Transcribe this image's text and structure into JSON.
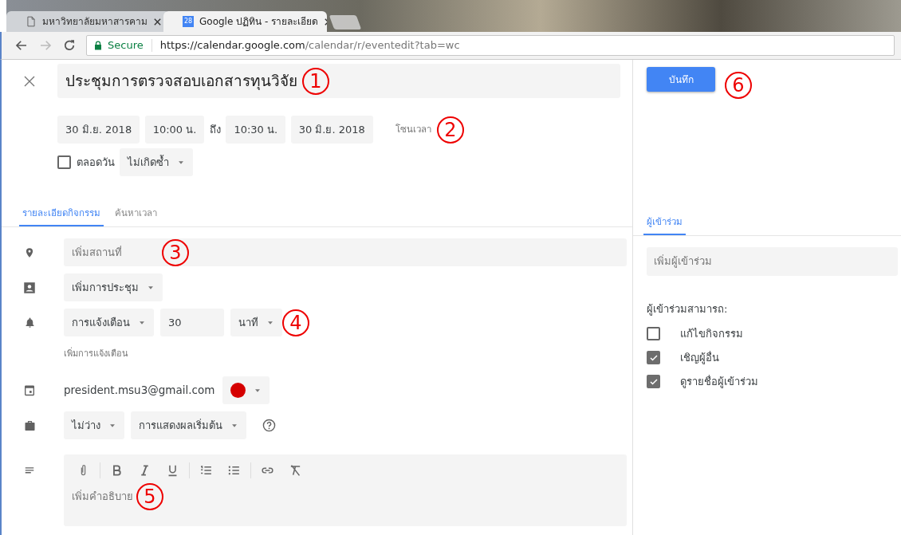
{
  "browser": {
    "tabs": [
      {
        "title": "มหาวิทยาลัยมหาสารคาม",
        "selected": false,
        "kind": "page"
      },
      {
        "title": "Google ปฏิทิน - รายละเอียด",
        "selected": true,
        "kind": "calendar",
        "favicon_text": "28"
      }
    ],
    "address": {
      "secure_label": "Secure",
      "url_host": "https://calendar.google.com",
      "url_path": "/calendar/r/eventedit?tab=wc"
    }
  },
  "event": {
    "title": "ประชุมการตรวจสอบเอกสารทุนวิจัย",
    "annotation": "1"
  },
  "save_button": {
    "label": "บันทึก",
    "annotation": "6"
  },
  "date_row": {
    "start_date": "30 มิ.ย. 2018",
    "start_time": "10:00 น.",
    "to_label": "ถึง",
    "end_time": "10:30 น.",
    "end_date": "30 มิ.ย. 2018",
    "timezone": "โซนเวลา",
    "annotation": "2"
  },
  "all_day": {
    "label": "ตลอดวัน",
    "checked": false
  },
  "repeat": "ไม่เกิดซ้ำ",
  "tabs": [
    {
      "label": "รายละเอียดกิจกรรม",
      "selected": true
    },
    {
      "label": "ค้นหาเวลา",
      "selected": false
    }
  ],
  "guests_tab": {
    "label": "ผู้เข้าร่วม",
    "selected": true
  },
  "location": {
    "placeholder": "เพิ่มสถานที่",
    "annotation": "3"
  },
  "conference": "เพิ่มการประชุม",
  "notification": {
    "type": "การแจ้งเตือน",
    "value": "30",
    "unit": "นาที",
    "annotation": "4"
  },
  "add_notification": "เพิ่มการแจ้งเตือน",
  "calendar": {
    "email": "president.msu3@gmail.com",
    "color": "#d50000"
  },
  "availability": "ไม่ว่าง",
  "visibility": "การแสดงผลเริ่มต้น",
  "description": {
    "placeholder": "เพิ่มคำอธิบาย",
    "annotation": "5"
  },
  "guests": {
    "placeholder": "เพิ่มผู้เข้าร่วม",
    "permissions_label": "ผู้เข้าร่วมสามารถ:",
    "permissions": [
      {
        "label": "แก้ไขกิจกรรม",
        "checked": false
      },
      {
        "label": "เชิญผู้อื่น",
        "checked": true
      },
      {
        "label": "ดูรายชื่อผู้เข้าร่วม",
        "checked": true
      }
    ]
  }
}
